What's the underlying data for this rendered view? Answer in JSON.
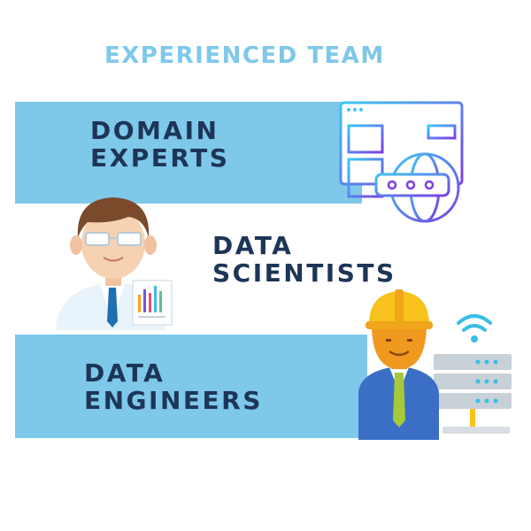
{
  "title": "EXPERIENCED TEAM",
  "teams": [
    {
      "line1": "DOMAIN",
      "line2": "EXPERTS",
      "icon": "web-browser-globe-icon"
    },
    {
      "line1": "DATA",
      "line2": "SCIENTISTS",
      "icon": "scientist-avatar-icon"
    },
    {
      "line1": "DATA",
      "line2": "ENGINEERS",
      "icon": "engineer-server-icon"
    }
  ],
  "colors": {
    "band": "#7ec8ea",
    "title": "#7ec8ea",
    "label": "#1d3557",
    "accent_gradient": [
      "#3cc6f5",
      "#7b3fe4"
    ]
  }
}
